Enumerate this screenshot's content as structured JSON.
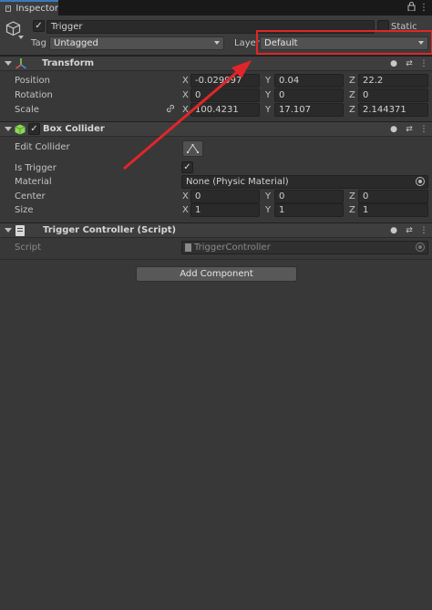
{
  "tab": {
    "label": "Inspector"
  },
  "header": {
    "object_name": "Trigger",
    "static_label": "Static",
    "tag_label": "Tag",
    "tag_value": "Untagged",
    "layer_label": "Layer",
    "layer_value": "Default"
  },
  "transform": {
    "title": "Transform",
    "rows": [
      {
        "label": "Position",
        "x": "-0.029997",
        "y": "0.04",
        "z": "22.2"
      },
      {
        "label": "Rotation",
        "x": "0",
        "y": "0",
        "z": "0"
      },
      {
        "label": "Scale",
        "x": "100.4231",
        "y": "17.107",
        "z": "2.144371"
      }
    ]
  },
  "box_collider": {
    "title": "Box Collider",
    "edit_collider_label": "Edit Collider",
    "is_trigger_label": "Is Trigger",
    "is_trigger_checked": "✓",
    "material_label": "Material",
    "material_value": "None (Physic Material)",
    "center": {
      "label": "Center",
      "x": "0",
      "y": "0",
      "z": "0"
    },
    "size": {
      "label": "Size",
      "x": "1",
      "y": "1",
      "z": "1"
    }
  },
  "trigger_controller": {
    "title": "Trigger Controller (Script)",
    "script_label": "Script",
    "script_value": "TriggerController"
  },
  "add_component_label": "Add Component",
  "axes": {
    "x": "X",
    "y": "Y",
    "z": "Z"
  },
  "icons": {
    "lock": "lock-icon",
    "menu": "kebab-menu-icon",
    "help": "help-icon",
    "presets": "presets-icon",
    "more": "more-icon"
  },
  "colors": {
    "annotation_red": "#e0262a",
    "panel_bg": "#383838",
    "header_bg": "#3e3e3e"
  }
}
